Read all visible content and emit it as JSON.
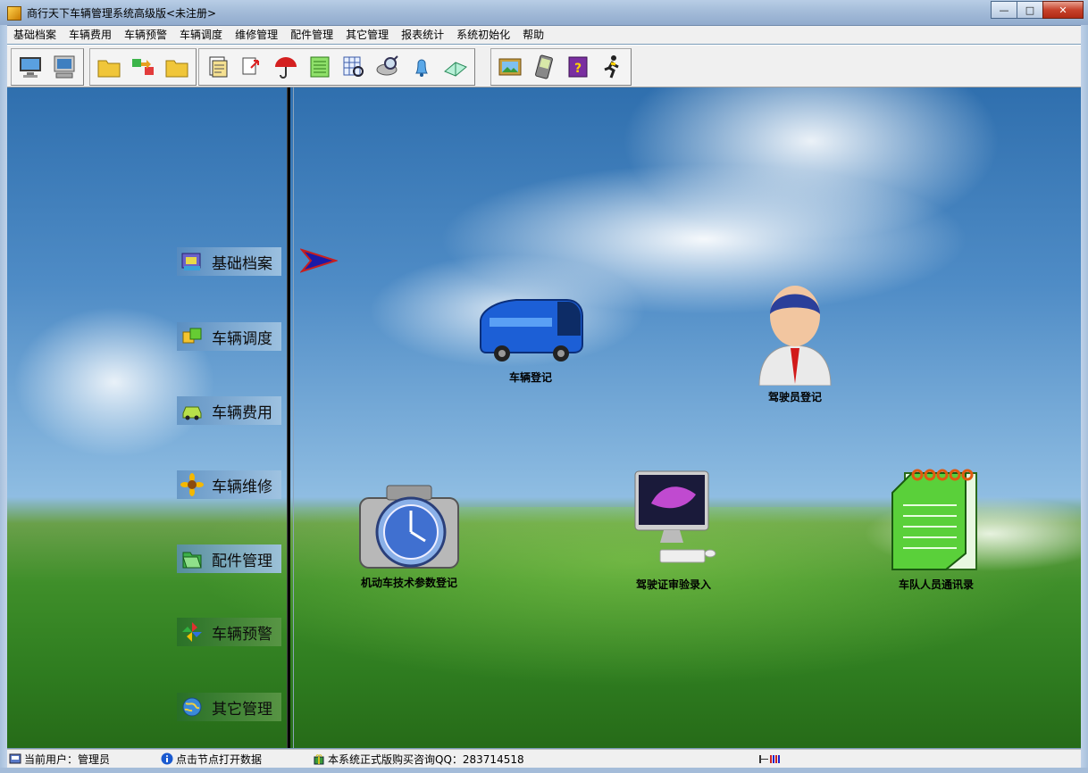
{
  "window": {
    "title": "商行天下车辆管理系统高级版<未注册>",
    "minimize_glyph": "—",
    "maximize_glyph": "□",
    "close_glyph": "✕"
  },
  "menu": {
    "items": [
      "基础档案",
      "车辆费用",
      "车辆预警",
      "车辆调度",
      "维修管理",
      "配件管理",
      "其它管理",
      "报表统计",
      "系统初始化",
      "帮助"
    ]
  },
  "toolbar": {
    "groups": [
      [
        "monitor-icon",
        "computer-icon"
      ],
      [
        "folder-icon",
        "exchange-icon",
        "folder-icon"
      ],
      [
        "documents-icon",
        "transfer-icon",
        "umbrella-icon",
        "notepad-icon",
        "grid-search-icon",
        "magnifier-icon",
        "bell-icon",
        "open-book-icon"
      ],
      [
        "picture-icon",
        "pda-icon",
        "help-book-icon",
        "exit-runner-icon"
      ]
    ]
  },
  "nav": {
    "items": [
      {
        "label": "基础档案",
        "icon": "archive-icon"
      },
      {
        "label": "车辆调度",
        "icon": "dispatch-icon"
      },
      {
        "label": "车辆费用",
        "icon": "car-cost-icon"
      },
      {
        "label": "车辆维修",
        "icon": "sunflower-icon"
      },
      {
        "label": "配件管理",
        "icon": "parts-folder-icon"
      },
      {
        "label": "车辆预警",
        "icon": "pinwheel-icon"
      },
      {
        "label": "其它管理",
        "icon": "globe-icon"
      }
    ]
  },
  "features": {
    "vehicle_register": "车辆登记",
    "driver_register": "驾驶员登记",
    "tech_params": "机动车技术参数登记",
    "license_review": "驾驶证审验录入",
    "team_contacts": "车队人员通讯录"
  },
  "status": {
    "current_user": "当前用户：管理员",
    "hint": "点击节点打开数据",
    "contact": "本系统正式版购买咨询QQ：283714518"
  },
  "colors": {
    "nav_light": "#a0c3e1",
    "nav_dark": "#3c8a3c",
    "divider": "#000000"
  }
}
